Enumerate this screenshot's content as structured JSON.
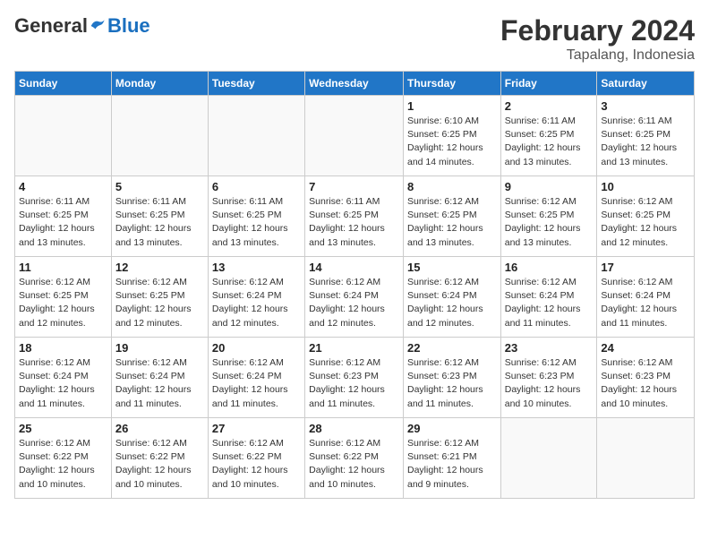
{
  "header": {
    "logo_general": "General",
    "logo_blue": "Blue",
    "month_title": "February 2024",
    "location": "Tapalang, Indonesia"
  },
  "days_of_week": [
    "Sunday",
    "Monday",
    "Tuesday",
    "Wednesday",
    "Thursday",
    "Friday",
    "Saturday"
  ],
  "weeks": [
    [
      {
        "day": "",
        "info": ""
      },
      {
        "day": "",
        "info": ""
      },
      {
        "day": "",
        "info": ""
      },
      {
        "day": "",
        "info": ""
      },
      {
        "day": "1",
        "info": "Sunrise: 6:10 AM\nSunset: 6:25 PM\nDaylight: 12 hours\nand 14 minutes."
      },
      {
        "day": "2",
        "info": "Sunrise: 6:11 AM\nSunset: 6:25 PM\nDaylight: 12 hours\nand 13 minutes."
      },
      {
        "day": "3",
        "info": "Sunrise: 6:11 AM\nSunset: 6:25 PM\nDaylight: 12 hours\nand 13 minutes."
      }
    ],
    [
      {
        "day": "4",
        "info": "Sunrise: 6:11 AM\nSunset: 6:25 PM\nDaylight: 12 hours\nand 13 minutes."
      },
      {
        "day": "5",
        "info": "Sunrise: 6:11 AM\nSunset: 6:25 PM\nDaylight: 12 hours\nand 13 minutes."
      },
      {
        "day": "6",
        "info": "Sunrise: 6:11 AM\nSunset: 6:25 PM\nDaylight: 12 hours\nand 13 minutes."
      },
      {
        "day": "7",
        "info": "Sunrise: 6:11 AM\nSunset: 6:25 PM\nDaylight: 12 hours\nand 13 minutes."
      },
      {
        "day": "8",
        "info": "Sunrise: 6:12 AM\nSunset: 6:25 PM\nDaylight: 12 hours\nand 13 minutes."
      },
      {
        "day": "9",
        "info": "Sunrise: 6:12 AM\nSunset: 6:25 PM\nDaylight: 12 hours\nand 13 minutes."
      },
      {
        "day": "10",
        "info": "Sunrise: 6:12 AM\nSunset: 6:25 PM\nDaylight: 12 hours\nand 12 minutes."
      }
    ],
    [
      {
        "day": "11",
        "info": "Sunrise: 6:12 AM\nSunset: 6:25 PM\nDaylight: 12 hours\nand 12 minutes."
      },
      {
        "day": "12",
        "info": "Sunrise: 6:12 AM\nSunset: 6:25 PM\nDaylight: 12 hours\nand 12 minutes."
      },
      {
        "day": "13",
        "info": "Sunrise: 6:12 AM\nSunset: 6:24 PM\nDaylight: 12 hours\nand 12 minutes."
      },
      {
        "day": "14",
        "info": "Sunrise: 6:12 AM\nSunset: 6:24 PM\nDaylight: 12 hours\nand 12 minutes."
      },
      {
        "day": "15",
        "info": "Sunrise: 6:12 AM\nSunset: 6:24 PM\nDaylight: 12 hours\nand 12 minutes."
      },
      {
        "day": "16",
        "info": "Sunrise: 6:12 AM\nSunset: 6:24 PM\nDaylight: 12 hours\nand 11 minutes."
      },
      {
        "day": "17",
        "info": "Sunrise: 6:12 AM\nSunset: 6:24 PM\nDaylight: 12 hours\nand 11 minutes."
      }
    ],
    [
      {
        "day": "18",
        "info": "Sunrise: 6:12 AM\nSunset: 6:24 PM\nDaylight: 12 hours\nand 11 minutes."
      },
      {
        "day": "19",
        "info": "Sunrise: 6:12 AM\nSunset: 6:24 PM\nDaylight: 12 hours\nand 11 minutes."
      },
      {
        "day": "20",
        "info": "Sunrise: 6:12 AM\nSunset: 6:24 PM\nDaylight: 12 hours\nand 11 minutes."
      },
      {
        "day": "21",
        "info": "Sunrise: 6:12 AM\nSunset: 6:23 PM\nDaylight: 12 hours\nand 11 minutes."
      },
      {
        "day": "22",
        "info": "Sunrise: 6:12 AM\nSunset: 6:23 PM\nDaylight: 12 hours\nand 11 minutes."
      },
      {
        "day": "23",
        "info": "Sunrise: 6:12 AM\nSunset: 6:23 PM\nDaylight: 12 hours\nand 10 minutes."
      },
      {
        "day": "24",
        "info": "Sunrise: 6:12 AM\nSunset: 6:23 PM\nDaylight: 12 hours\nand 10 minutes."
      }
    ],
    [
      {
        "day": "25",
        "info": "Sunrise: 6:12 AM\nSunset: 6:22 PM\nDaylight: 12 hours\nand 10 minutes."
      },
      {
        "day": "26",
        "info": "Sunrise: 6:12 AM\nSunset: 6:22 PM\nDaylight: 12 hours\nand 10 minutes."
      },
      {
        "day": "27",
        "info": "Sunrise: 6:12 AM\nSunset: 6:22 PM\nDaylight: 12 hours\nand 10 minutes."
      },
      {
        "day": "28",
        "info": "Sunrise: 6:12 AM\nSunset: 6:22 PM\nDaylight: 12 hours\nand 10 minutes."
      },
      {
        "day": "29",
        "info": "Sunrise: 6:12 AM\nSunset: 6:21 PM\nDaylight: 12 hours\nand 9 minutes."
      },
      {
        "day": "",
        "info": ""
      },
      {
        "day": "",
        "info": ""
      }
    ]
  ]
}
